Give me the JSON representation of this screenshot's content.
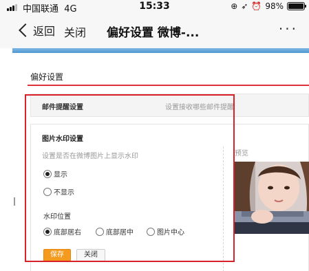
{
  "status_bar": {
    "carrier": "中国联通",
    "network": "4G",
    "time": "15:33",
    "battery_text": "98%",
    "battery_level": 0.98
  },
  "nav": {
    "back_label": "返回",
    "close_label": "关闭",
    "title": "偏好设置 微博-...",
    "more_label": "···"
  },
  "page": {
    "load_progress": 1.0,
    "section_title": "偏好设置",
    "mail": {
      "title": "邮件提醒设置",
      "description": "设置接收哪些邮件提醒"
    },
    "watermark": {
      "title": "图片水印设置",
      "description": "设置是否在微博图片上显示水印",
      "show_option": "显示",
      "hide_option": "不显示",
      "show_selected": true,
      "position_label": "水印位置",
      "positions": [
        "底部居右",
        "底部居中",
        "图片中心"
      ],
      "selected_position": "底部居右",
      "save_label": "保存",
      "cancel_label": "关闭",
      "preview_label": "预览"
    }
  },
  "colors": {
    "accent_red": "#e0303a",
    "save_orange": "#f39a1f",
    "progress_blue": "#4f98d2"
  }
}
